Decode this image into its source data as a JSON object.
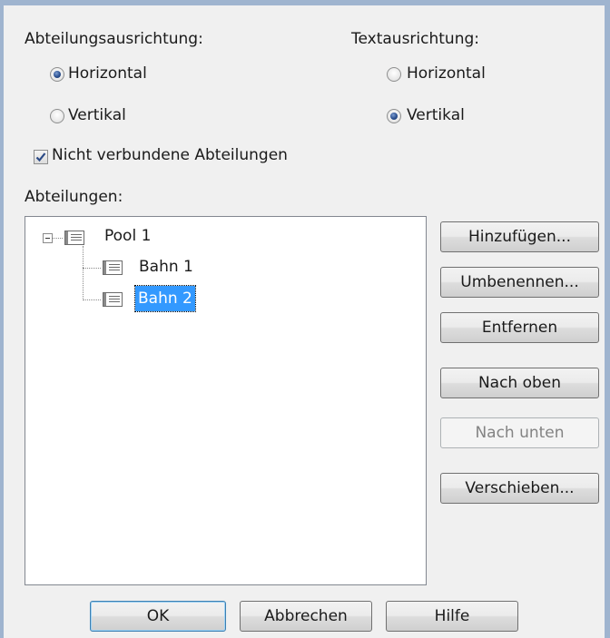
{
  "dept_orientation": {
    "label": "Abteilungsausrichtung:",
    "options": [
      {
        "label": "Horizontal",
        "selected": true
      },
      {
        "label": "Vertikal",
        "selected": false
      }
    ]
  },
  "text_orientation": {
    "label": "Textausrichtung:",
    "options": [
      {
        "label": "Horizontal",
        "selected": false
      },
      {
        "label": "Vertikal",
        "selected": true
      }
    ]
  },
  "unconnected": {
    "label": "Nicht verbundene Abteilungen",
    "checked": true
  },
  "departments": {
    "label": "Abteilungen:",
    "tree": [
      {
        "label": "Pool 1",
        "expanded": true,
        "children": [
          {
            "label": "Bahn 1",
            "selected": false
          },
          {
            "label": "Bahn 2",
            "selected": true
          }
        ]
      }
    ]
  },
  "side_buttons": {
    "add": "Hinzufügen...",
    "rename": "Umbenennen...",
    "remove": "Entfernen",
    "up": "Nach oben",
    "down": "Nach unten",
    "move": "Verschieben..."
  },
  "dialog_buttons": {
    "ok": "OK",
    "cancel": "Abbrechen",
    "help": "Hilfe"
  },
  "colors": {
    "selection": "#3399ff",
    "window_frame": "#9fb4cf"
  }
}
